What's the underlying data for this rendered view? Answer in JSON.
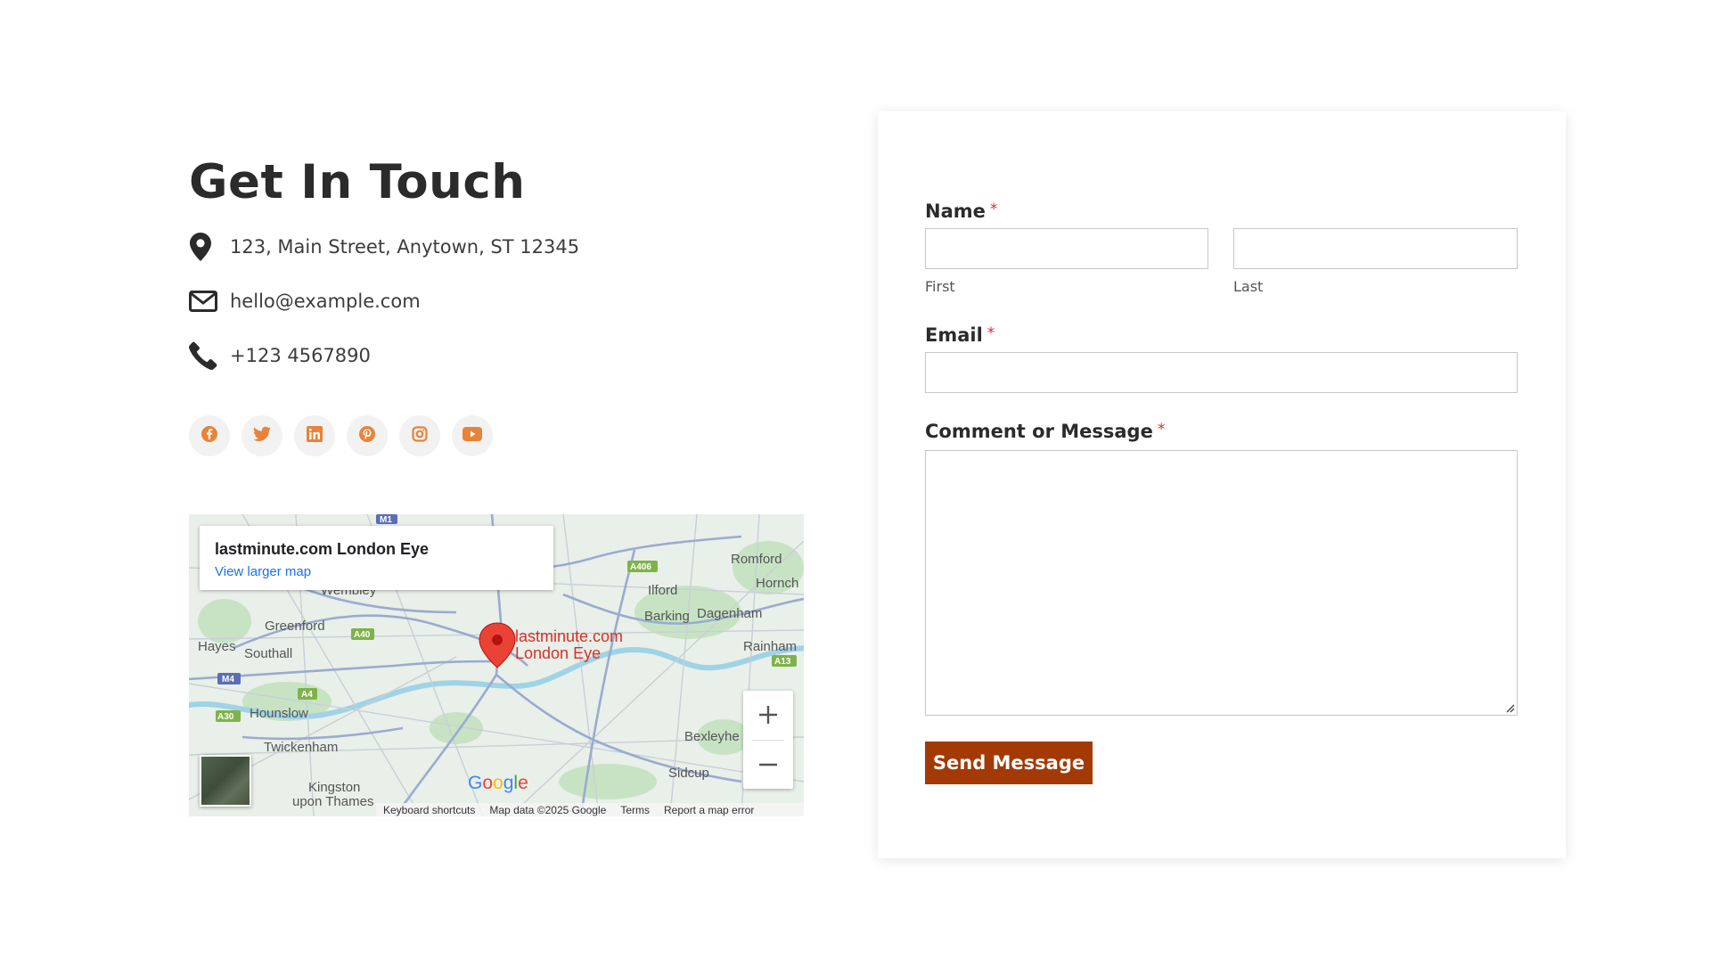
{
  "contact": {
    "title": "Get In Touch",
    "address": "123, Main Street, Anytown, ST 12345",
    "email": "hello@example.com",
    "phone": "+123 4567890",
    "icons": [
      "map-pin-icon",
      "envelope-icon",
      "phone-icon"
    ]
  },
  "socials": [
    {
      "name": "facebook-icon"
    },
    {
      "name": "twitter-icon"
    },
    {
      "name": "linkedin-icon"
    },
    {
      "name": "pinterest-icon"
    },
    {
      "name": "instagram-icon"
    },
    {
      "name": "youtube-icon"
    }
  ],
  "map": {
    "place_name": "lastminute.com London Eye",
    "view_larger": "View larger map",
    "marker_label_1": "lastminute.com",
    "marker_label_2": "London Eye",
    "zoom_in": "+",
    "zoom_out": "−",
    "google": "Google",
    "attribution": {
      "shortcuts": "Keyboard shortcuts",
      "data": "Map data ©2025 Google",
      "terms": "Terms",
      "report": "Report a map error"
    },
    "places": [
      "Romford",
      "Hornch",
      "Ilford",
      "Barking",
      "Dagenham",
      "Rainham",
      "Greenford",
      "Hayes",
      "Southall",
      "Hounslow",
      "Twickenham",
      "Kingston",
      "upon Thames",
      "Bexleyhe",
      "Sidcup",
      "Wembley"
    ],
    "roads": [
      "M1",
      "A406",
      "A40",
      "M4",
      "A4",
      "A30",
      "A13"
    ]
  },
  "form": {
    "name_label": "Name",
    "required_mark": "*",
    "first_sub": "First",
    "last_sub": "Last",
    "email_label": "Email",
    "message_label": "Comment or Message",
    "submit_label": "Send Message"
  },
  "colors": {
    "accent": "#a33a06",
    "social_icon": "#e8833a",
    "social_bg": "#f2f2f2",
    "required": "#d32f2f"
  }
}
